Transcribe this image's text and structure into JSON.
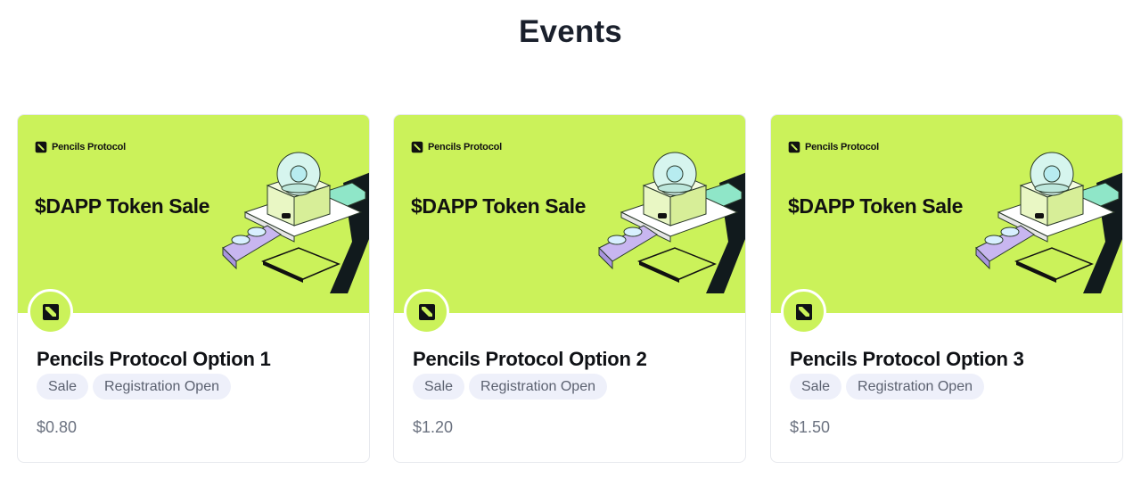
{
  "page": {
    "title": "Events"
  },
  "colors": {
    "banner": "#cbf25a",
    "tag_bg": "#eef0fa",
    "text_dark": "#111827",
    "text_muted": "#6b7280"
  },
  "events": [
    {
      "banner": {
        "brand": "Pencils Protocol",
        "headline": "$DAPP Token Sale"
      },
      "logo_icon": "pencils-protocol-logo-icon",
      "title": "Pencils Protocol Option 1",
      "tags": [
        "Sale",
        "Registration Open"
      ],
      "price": "$0.80"
    },
    {
      "banner": {
        "brand": "Pencils Protocol",
        "headline": "$DAPP Token Sale"
      },
      "logo_icon": "pencils-protocol-logo-icon",
      "title": "Pencils Protocol Option 2",
      "tags": [
        "Sale",
        "Registration Open"
      ],
      "price": "$1.20"
    },
    {
      "banner": {
        "brand": "Pencils Protocol",
        "headline": "$DAPP Token Sale"
      },
      "logo_icon": "pencils-protocol-logo-icon",
      "title": "Pencils Protocol Option 3",
      "tags": [
        "Sale",
        "Registration Open"
      ],
      "price": "$1.50"
    }
  ]
}
